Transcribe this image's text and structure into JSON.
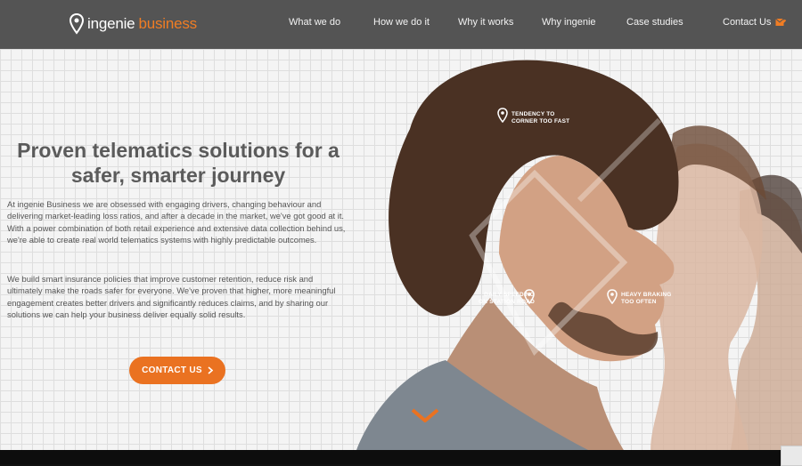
{
  "brand": {
    "word1": "ingenie",
    "word2": "business"
  },
  "nav": {
    "items": [
      {
        "label": "What we do"
      },
      {
        "label": "How we do it"
      },
      {
        "label": "Why it works"
      },
      {
        "label": "Why ingenie"
      },
      {
        "label": "Case studies"
      },
      {
        "label": "Contact Us"
      }
    ]
  },
  "hero": {
    "headline_line1": "Proven telematics solutions for a",
    "headline_line2": "safer, smarter journey",
    "paragraph1": "At ingenie Business we are obsessed with engaging drivers, changing behaviour and delivering market-leading loss ratios, and after a decade in the market, we've got good at it. With a power combination of both retail experience and extensive data collection behind us, we're able to create real world telematics systems with highly predictable outcomes.",
    "paragraph2": "We build smart insurance policies that improve customer retention, reduce risk and ultimately make the roads safer for everyone. We've proven that higher, more meaningful engagement creates better drivers and significantly reduces claims, and by sharing our solutions we can help your business deliver equally solid results.",
    "cta_label": "CONTACT US"
  },
  "photo_labels": {
    "tag1_line1": "TENDENCY TO",
    "tag1_line2": "CORNER TOO FAST",
    "tag2_line1": "DAILY SPEEDING",
    "tag2_line2": "ON STATION ROAD",
    "tag3_line1": "HEAVY BRAKING",
    "tag3_line2": "TOO OFTEN"
  },
  "colors": {
    "accent": "#f07d24",
    "header": "#545454",
    "text": "#555555"
  },
  "icons": [
    "location-pin-icon",
    "contact-envelope-icon",
    "chevron-right-icon",
    "chevron-down-icon"
  ]
}
